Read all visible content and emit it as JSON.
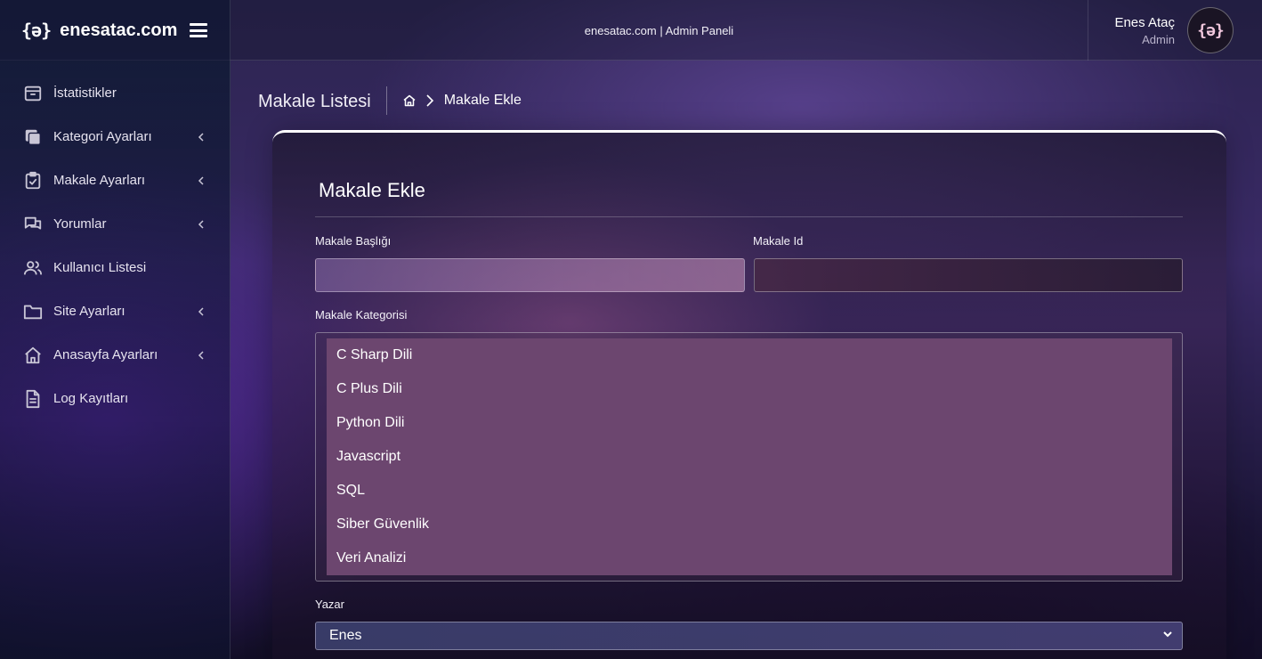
{
  "brand": {
    "logo": "{ə}",
    "name": "enesatac.com"
  },
  "header": {
    "center_title": "enesatac.com | Admin Paneli"
  },
  "user": {
    "name": "Enes Ataç",
    "role": "Admin",
    "avatar_text": "{ə}"
  },
  "sidebar": {
    "items": [
      {
        "label": "İstatistikler",
        "icon": "archive-box-icon",
        "has_submenu": false
      },
      {
        "label": "Kategori Ayarları",
        "icon": "stacked-squares-icon",
        "has_submenu": true
      },
      {
        "label": "Makale Ayarları",
        "icon": "clipboard-check-icon",
        "has_submenu": true
      },
      {
        "label": "Yorumlar",
        "icon": "chat-bubbles-icon",
        "has_submenu": true
      },
      {
        "label": "Kullanıcı Listesi",
        "icon": "users-icon",
        "has_submenu": false
      },
      {
        "label": "Site Ayarları",
        "icon": "folder-icon",
        "has_submenu": true
      },
      {
        "label": "Anasayfa Ayarları",
        "icon": "home-icon",
        "has_submenu": true
      },
      {
        "label": "Log Kayıtları",
        "icon": "document-icon",
        "has_submenu": false
      }
    ]
  },
  "page": {
    "title": "Makale Listesi",
    "breadcrumb_current": "Makale Ekle"
  },
  "form": {
    "title": "Makale Ekle",
    "article_title_label": "Makale Başlığı",
    "article_title_value": "",
    "article_id_label": "Makale Id",
    "article_id_value": "",
    "category_label": "Makale Kategorisi",
    "categories": [
      "C Sharp Dili",
      "C Plus Dili",
      "Python Dili",
      "Javascript",
      "SQL",
      "Siber Güvenlik",
      "Veri Analizi"
    ],
    "author_label": "Yazar",
    "author_value": "Enes"
  },
  "colors": {
    "accent_border": "#ffffff",
    "listbox_selected": "#6c466f"
  }
}
